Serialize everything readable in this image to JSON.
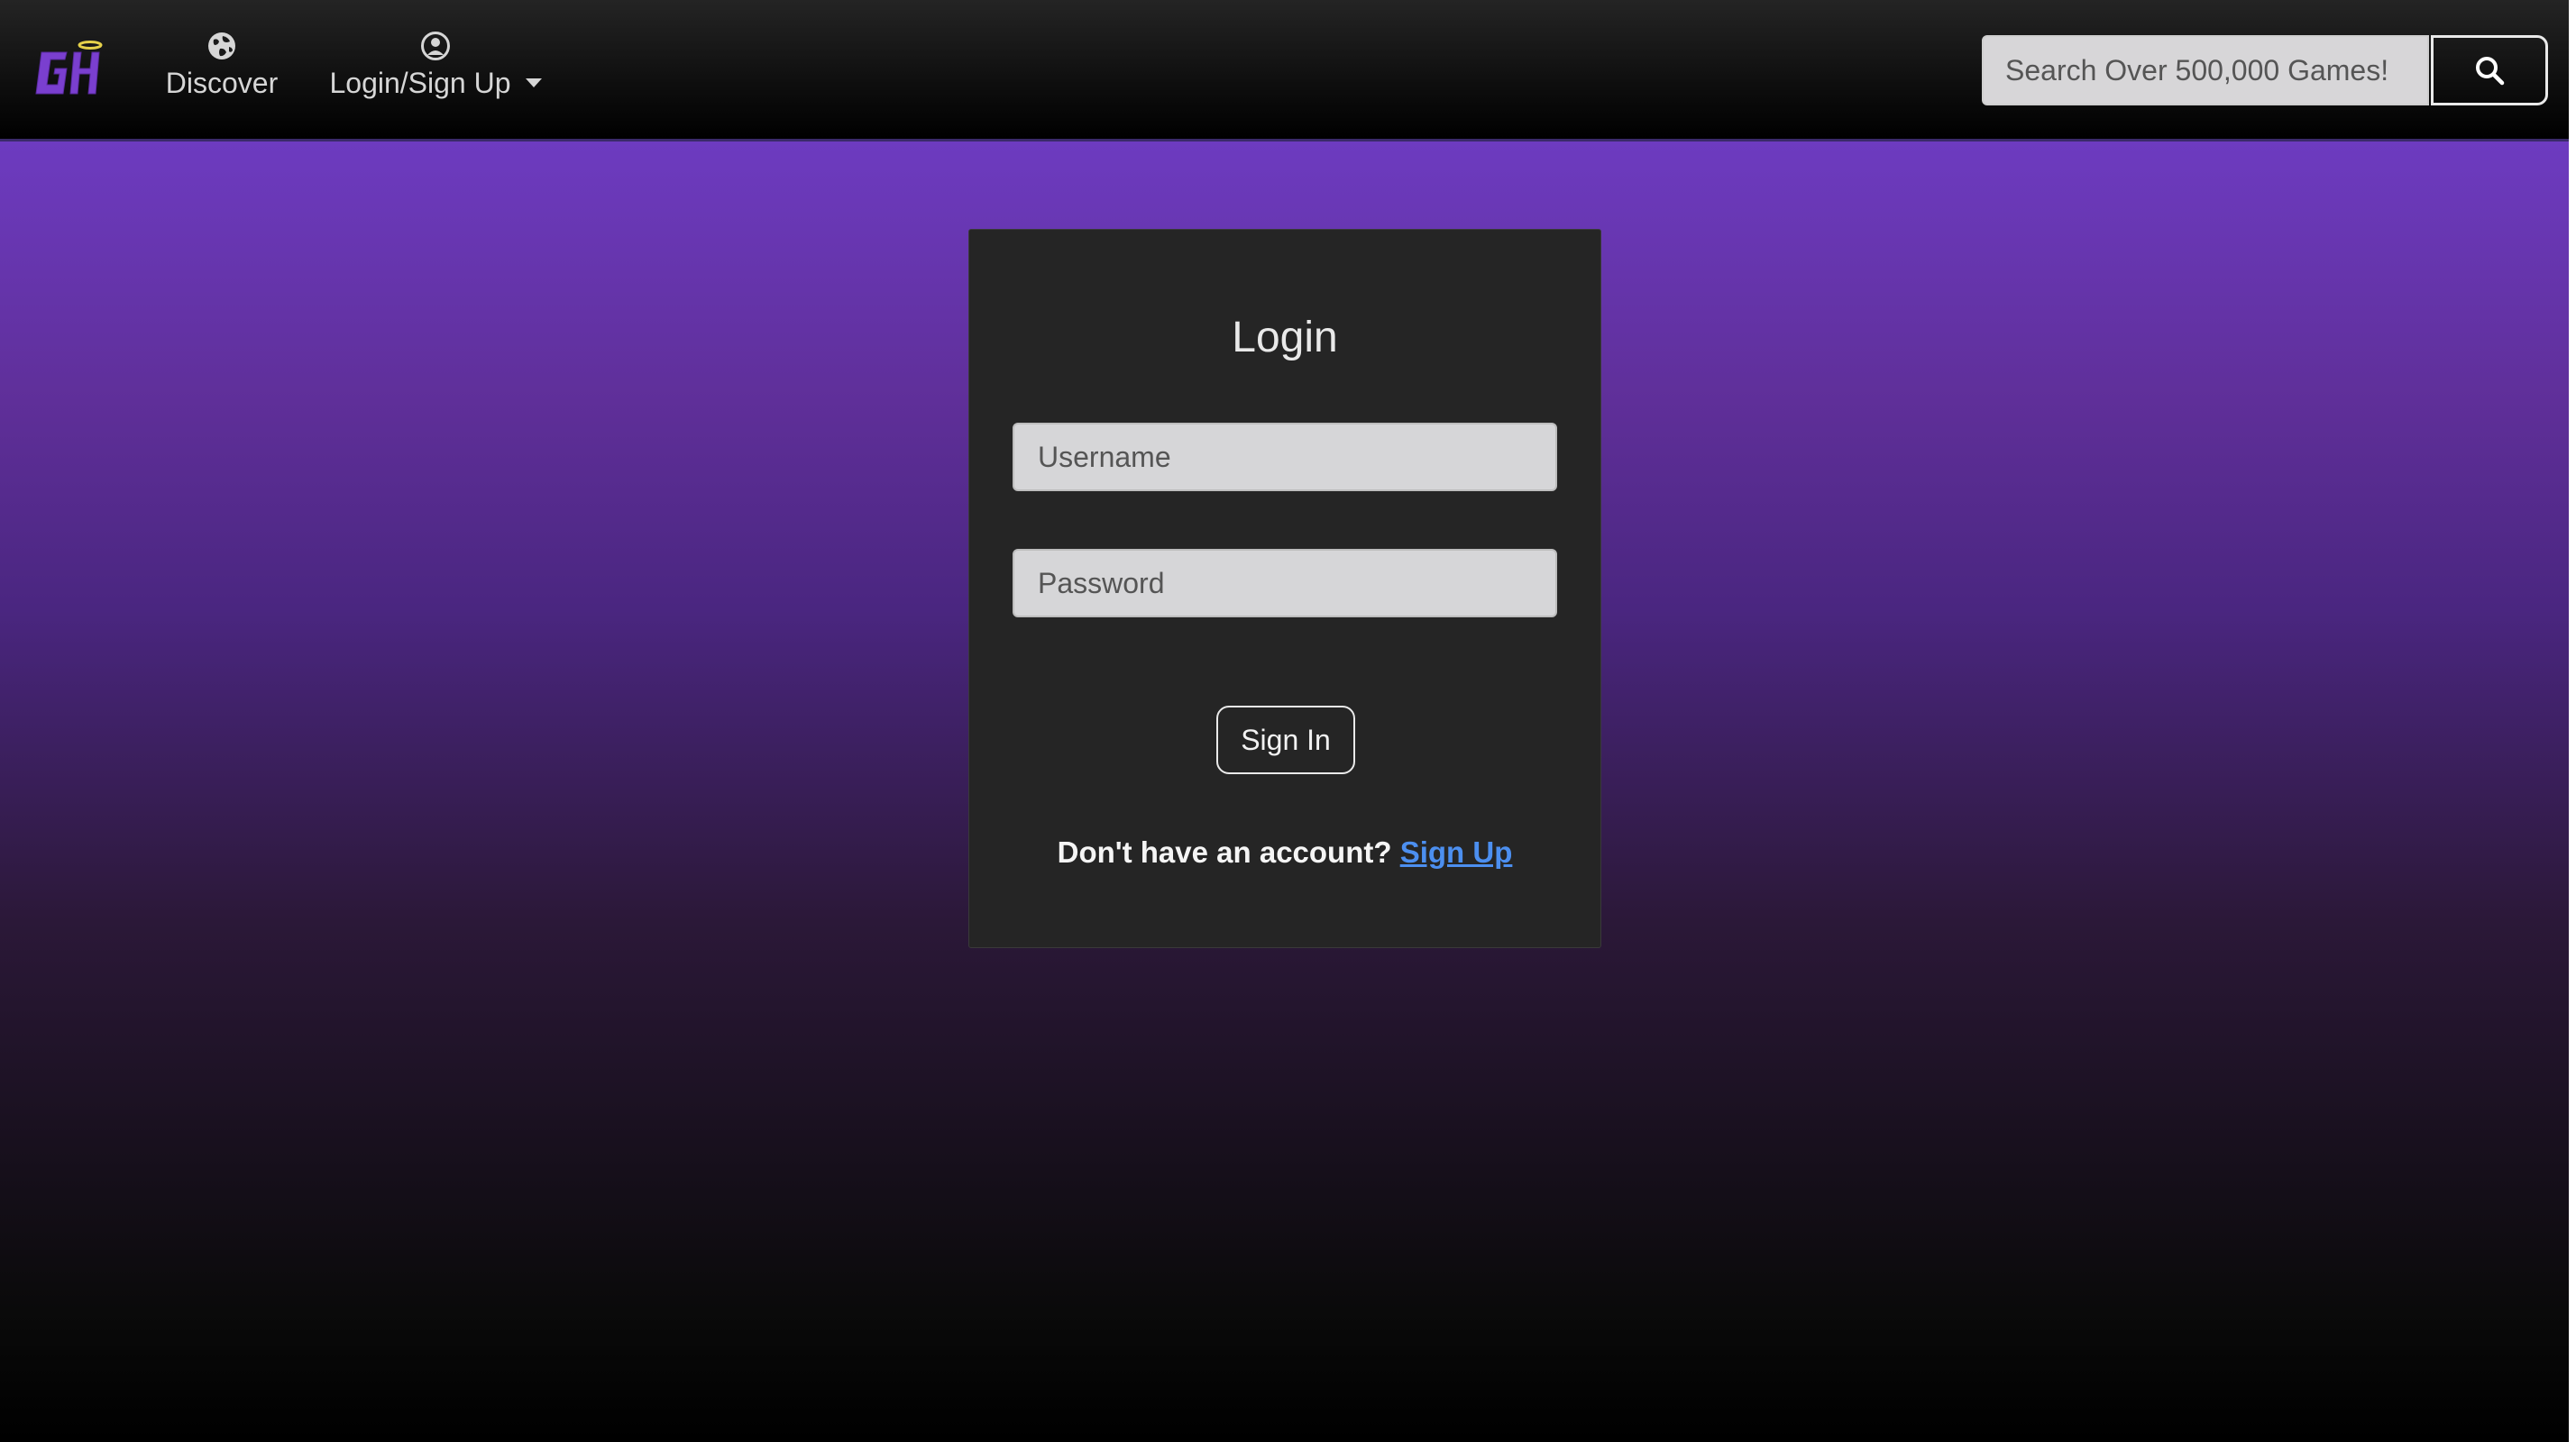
{
  "navbar": {
    "logo_text": "GH",
    "logo_icon": "gh-logo-with-halo",
    "discover": {
      "label": "Discover",
      "icon": "globe-icon"
    },
    "login": {
      "label": "Login/Sign Up",
      "icon": "user-circle-icon"
    },
    "search": {
      "placeholder": "Search Over 500,000 Games!",
      "icon": "search-icon"
    }
  },
  "login_card": {
    "title": "Login",
    "username_placeholder": "Username",
    "password_placeholder": "Password",
    "signin_label": "Sign In",
    "no_account_text": "Don't have an account?",
    "signup_link": "Sign Up"
  },
  "colors": {
    "accent_purple": "#6d3bc0",
    "logo_purple": "#7a3fcf",
    "halo_yellow": "#e6d24a",
    "link_blue": "#4c8ff0",
    "card_bg": "#252525"
  }
}
